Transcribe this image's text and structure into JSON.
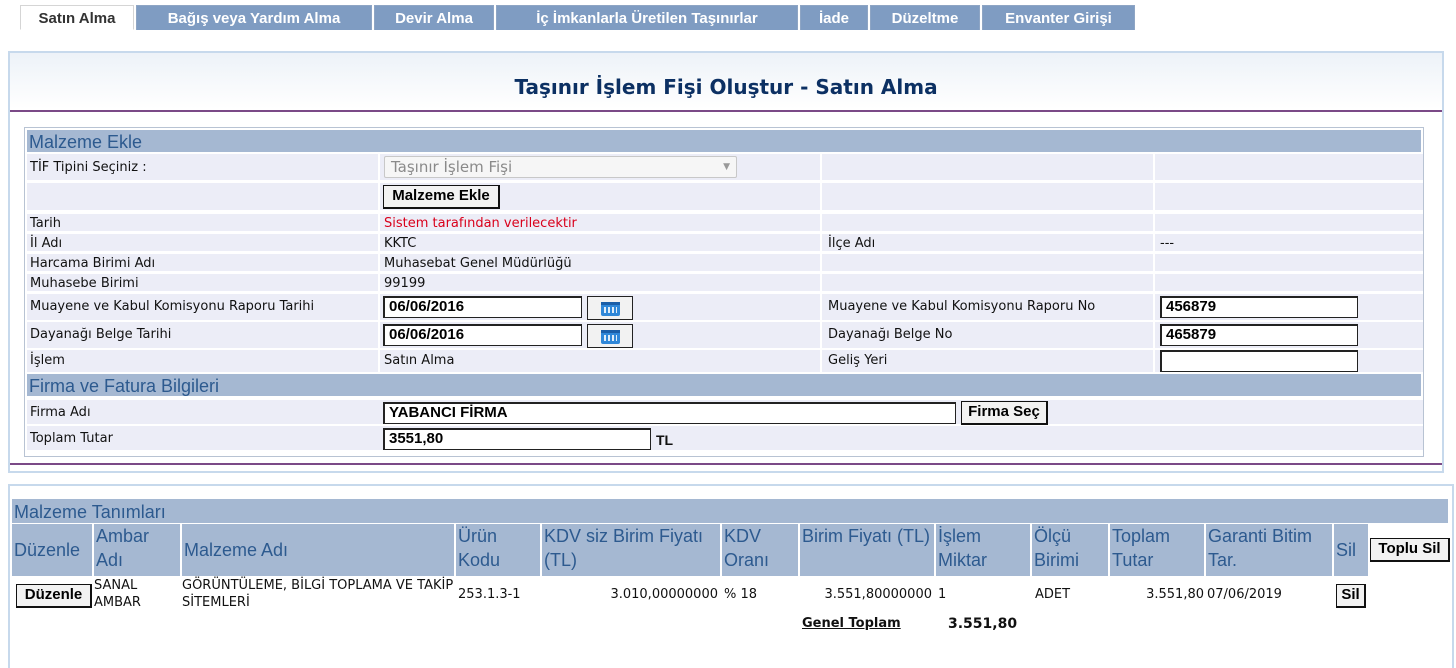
{
  "tabs": [
    {
      "label": "Satın Alma",
      "active": true
    },
    {
      "label": "Bağış veya Yardım Alma"
    },
    {
      "label": "Devir Alma"
    },
    {
      "label": "İç İmkanlarla Üretilen Taşınırlar"
    },
    {
      "label": "İade"
    },
    {
      "label": "Düzeltme"
    },
    {
      "label": "Envanter Girişi"
    }
  ],
  "page_title": "Taşınır İşlem Fişi Oluştur - Satın Alma",
  "malzeme_ekle": {
    "heading": "Malzeme Ekle",
    "tif_label": "TİF Tipini Seçiniz :",
    "tif_value": "Taşınır İşlem Fişi",
    "add_button": "Malzeme Ekle",
    "tarih_label": "Tarih",
    "tarih_value": "Sistem tarafından verilecektir",
    "il_label": "İl Adı",
    "il_value": "KKTC",
    "ilce_label": "İlçe Adı",
    "ilce_value": "---",
    "harcama_label": "Harcama Birimi Adı",
    "harcama_value": "Muhasebat Genel Müdürlüğü",
    "muhasebe_label": "Muhasebe Birimi",
    "muhasebe_value": "99199",
    "muayene_tarih_label": "Muayene ve Kabul Komisyonu Raporu Tarihi",
    "muayene_tarih_value": "06/06/2016",
    "muayene_no_label": "Muayene ve Kabul Komisyonu Raporu No",
    "muayene_no_value": "456879",
    "dayanak_tarih_label": "Dayanağı Belge Tarihi",
    "dayanak_tarih_value": "06/06/2016",
    "dayanak_no_label": "Dayanağı Belge No",
    "dayanak_no_value": "465879",
    "islem_label": "İşlem",
    "islem_value": "Satın Alma",
    "gelis_label": "Geliş Yeri",
    "gelis_value": ""
  },
  "firma": {
    "heading": "Firma ve Fatura Bilgileri",
    "firma_label": "Firma Adı",
    "firma_value": "YABANCI FİRMA",
    "firma_button": "Firma Seç",
    "toplam_label": "Toplam Tutar",
    "toplam_value": "3551,80",
    "currency": "TL"
  },
  "malzeme_tanimlari": {
    "heading": "Malzeme Tanımları",
    "columns": {
      "duzenle": "Düzenle",
      "ambar": "Ambar Adı",
      "malzeme": "Malzeme Adı",
      "urun": "Ürün Kodu",
      "kdvsiz": "KDV siz Birim Fiyatı (TL)",
      "kdv": "KDV Oranı",
      "birim": "Birim Fiyatı (TL)",
      "miktar": "İşlem Miktar",
      "olcu": "Ölçü Birimi",
      "toplam": "Toplam Tutar",
      "garanti": "Garanti Bitim Tar.",
      "sil": "Sil"
    },
    "bulk_delete_button": "Toplu Sil",
    "rows": [
      {
        "edit_button": "Düzenle",
        "ambar": "SANAL AMBAR",
        "malzeme": "GÖRÜNTÜLEME, BİLGİ TOPLAMA VE TAKİP SİTEMLERİ",
        "urun_kodu": "253.1.3-1",
        "kdvsiz_fiyat": "3.010,00000000",
        "kdv_orani": "% 18",
        "birim_fiyat": "3.551,80000000",
        "miktar": "1",
        "olcu": "ADET",
        "toplam": "3.551,80",
        "garanti": "07/06/2019",
        "delete_button": "Sil"
      }
    ],
    "genel_toplam_label": "Genel Toplam",
    "genel_toplam_value": "3.551,80"
  },
  "colors": {
    "tab_bg": "#7f9cc2",
    "section_bg": "#a5b8d2",
    "section_text": "#2d5a8f",
    "row_bg": "#ecedf7",
    "title_text": "#0c3063",
    "divider": "#7b4a87",
    "warning_text": "#d9001b"
  }
}
